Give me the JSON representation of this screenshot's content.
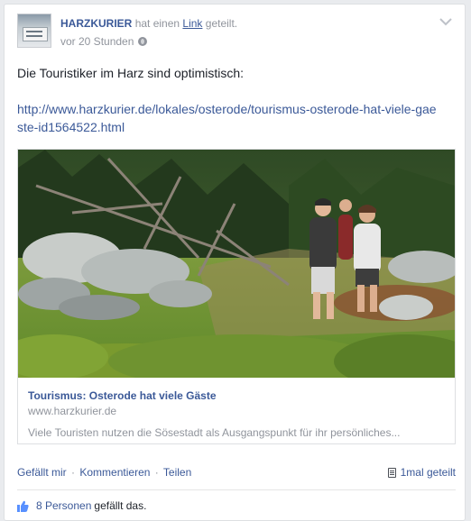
{
  "post": {
    "page_name": "HARZKURIER",
    "shared_text_1": "hat einen",
    "shared_link_word": "Link",
    "shared_text_2": "geteilt.",
    "time": "vor 20 Stunden",
    "privacy_icon": "globe-icon",
    "menu_icon": "chevron-down-icon",
    "text": "Die Touristiker im Harz sind optimistisch:",
    "link_url": "http://www.harzkurier.de/lokales/osterode/tourismus-osterode-hat-viele-gaeste-id1564522.html"
  },
  "attachment": {
    "image_alt": "Wandergruppe im Harz",
    "title": "Tourismus: Osterode hat viele Gäste",
    "domain": "www.harzkurier.de",
    "description": "Viele Touristen nutzen die Sösestadt als Ausgangspunkt für ihr persönliches..."
  },
  "actions": {
    "like": "Gefällt mir",
    "comment": "Kommentieren",
    "share": "Teilen",
    "separator": "·",
    "shares_count": "1mal geteilt"
  },
  "likes": {
    "count_link": "8 Personen",
    "text": "gefällt das."
  },
  "colors": {
    "link": "#3b5998",
    "meta": "#90949c",
    "background": "#e9ebee"
  }
}
